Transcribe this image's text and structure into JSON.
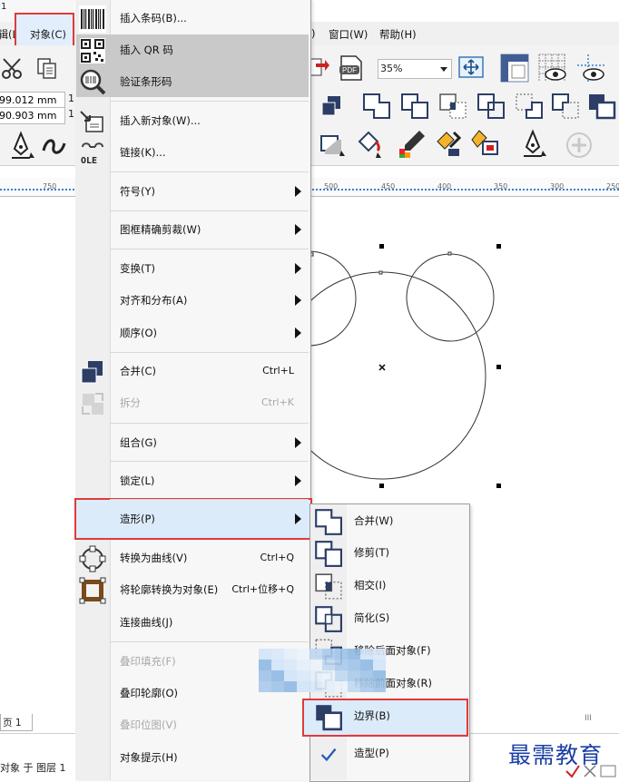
{
  "app": {
    "corner_glyph": "1",
    "menubar": {
      "edit_partial": "编辑(L",
      "object_menu": "对象(C)",
      "window": "窗口(W)",
      "help": "帮助(H)"
    },
    "zoom": "35%",
    "pos_x": "99.012 mm",
    "pos_y": "90.903 mm",
    "size_x_partial": "1",
    "size_y_partial": "1",
    "ruler_ticks": [
      "750",
      "500",
      "450",
      "400",
      "350",
      "300",
      "250"
    ],
    "page_tab": "页 1",
    "status_text": "对象 于 图层 1",
    "pdf_label": "PDF",
    "scroll_glyph": "III"
  },
  "menu": {
    "items": [
      {
        "id": "insert-barcode",
        "label": "插入条码(B)...",
        "shortcut": "",
        "arrow": false,
        "disabled": false,
        "icon": "barcode-icon"
      },
      {
        "id": "insert-qr",
        "label": "插入 QR 码",
        "shortcut": "",
        "arrow": false,
        "disabled": false,
        "icon": "qr-code-icon"
      },
      {
        "id": "verify-barcode",
        "label": "验证条形码",
        "shortcut": "",
        "arrow": false,
        "disabled": false,
        "icon": "magnifier-barcode-icon"
      },
      {
        "id": "insert-new-object",
        "label": "插入新对象(W)...",
        "shortcut": "",
        "arrow": false,
        "disabled": false,
        "icon": "insert-object-icon"
      },
      {
        "id": "links",
        "label": "链接(K)...",
        "shortcut": "",
        "arrow": false,
        "disabled": false,
        "icon": "ole-link-icon",
        "icon_text": "OLE"
      },
      {
        "id": "symbols",
        "label": "符号(Y)",
        "shortcut": "",
        "arrow": true,
        "disabled": false,
        "icon": ""
      },
      {
        "id": "powerclip",
        "label": "图框精确剪裁(W)",
        "shortcut": "",
        "arrow": true,
        "disabled": false,
        "icon": ""
      },
      {
        "id": "transform",
        "label": "变换(T)",
        "shortcut": "",
        "arrow": true,
        "disabled": false,
        "icon": ""
      },
      {
        "id": "align-distribute",
        "label": "对齐和分布(A)",
        "shortcut": "",
        "arrow": true,
        "disabled": false,
        "icon": ""
      },
      {
        "id": "order",
        "label": "顺序(O)",
        "shortcut": "",
        "arrow": true,
        "disabled": false,
        "icon": ""
      },
      {
        "id": "combine",
        "label": "合并(C)",
        "shortcut": "Ctrl+L",
        "arrow": false,
        "disabled": false,
        "icon": "combine-icon"
      },
      {
        "id": "break-apart",
        "label": "拆分",
        "shortcut": "Ctrl+K",
        "arrow": false,
        "disabled": true,
        "icon": "break-apart-icon"
      },
      {
        "id": "group",
        "label": "组合(G)",
        "shortcut": "",
        "arrow": true,
        "disabled": false,
        "icon": ""
      },
      {
        "id": "lock",
        "label": "锁定(L)",
        "shortcut": "",
        "arrow": true,
        "disabled": false,
        "icon": ""
      },
      {
        "id": "shaping",
        "label": "造形(P)",
        "shortcut": "",
        "arrow": true,
        "disabled": false,
        "icon": "",
        "active": true
      },
      {
        "id": "convert-to-curves",
        "label": "转换为曲线(V)",
        "shortcut": "Ctrl+Q",
        "arrow": false,
        "disabled": false,
        "icon": "convert-curves-icon"
      },
      {
        "id": "outline-to-object",
        "label": "将轮廓转换为对象(E)",
        "shortcut": "Ctrl+位移+Q",
        "arrow": false,
        "disabled": false,
        "icon": "outline-to-object-icon"
      },
      {
        "id": "join-curves",
        "label": "连接曲线(J)",
        "shortcut": "",
        "arrow": false,
        "disabled": false,
        "icon": ""
      },
      {
        "id": "overprint-fill",
        "label": "叠印填充(F)",
        "shortcut": "",
        "arrow": false,
        "disabled": true,
        "icon": ""
      },
      {
        "id": "overprint-outline",
        "label": "叠印轮廓(O)",
        "shortcut": "",
        "arrow": false,
        "disabled": false,
        "icon": ""
      },
      {
        "id": "overprint-bitmap",
        "label": "叠印位图(V)",
        "shortcut": "",
        "arrow": false,
        "disabled": true,
        "icon": ""
      },
      {
        "id": "object-hints",
        "label": "对象提示(H)",
        "shortcut": "",
        "arrow": false,
        "disabled": false,
        "icon": ""
      }
    ]
  },
  "submenu": {
    "items": [
      {
        "id": "weld",
        "label": "合并(W)",
        "icon": "weld-icon"
      },
      {
        "id": "trim",
        "label": "修剪(T)",
        "icon": "trim-icon"
      },
      {
        "id": "intersect",
        "label": "相交(I)",
        "icon": "intersect-icon"
      },
      {
        "id": "simplify",
        "label": "简化(S)",
        "icon": "simplify-icon"
      },
      {
        "id": "front-minus-back",
        "label": "移除后面对象(F)",
        "icon": "front-minus-back-icon"
      },
      {
        "id": "back-minus-front",
        "label": "移除前面对象(R)",
        "icon": "back-minus-front-icon"
      },
      {
        "id": "boundary",
        "label": "边界(B)",
        "icon": "boundary-icon",
        "highlighted": true
      },
      {
        "id": "shaping-docker",
        "label": "造型(P)",
        "icon": "checkmark-icon",
        "checked": true
      }
    ]
  },
  "watermark": "最需教育",
  "colors": {
    "highlight_border": "#e03a3a",
    "highlight_fill": "#dcebfa",
    "gray_highlight": "#c9c9c9",
    "icon_navy": "#2c3e66",
    "watermark_blue": "#1b3fa5"
  }
}
